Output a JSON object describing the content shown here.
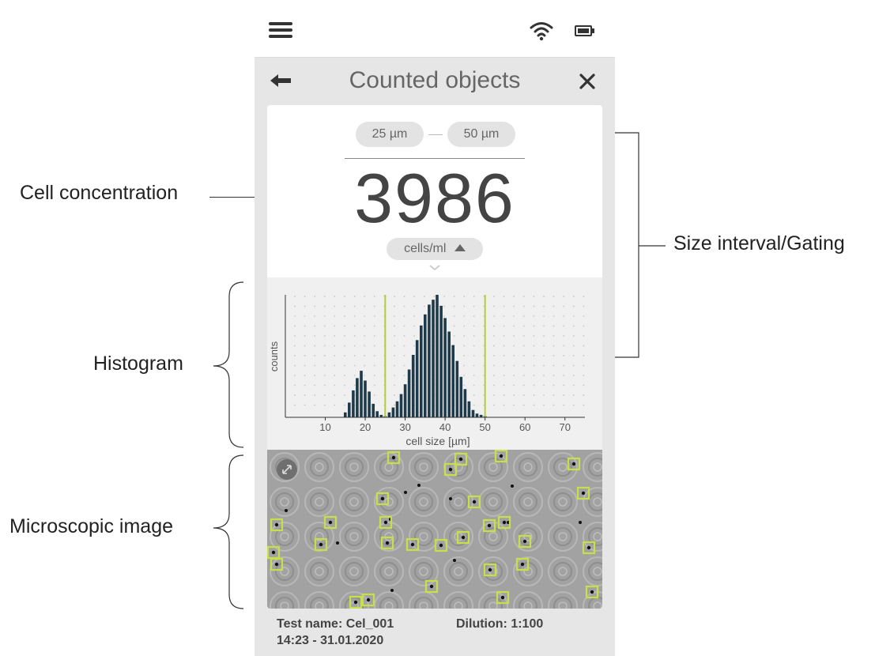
{
  "annotations": {
    "cell_concentration": "Cell concentration",
    "histogram": "Histogram",
    "microscopic_image": "Microscopic image",
    "size_interval": "Size interval/Gating"
  },
  "status_bar": {
    "menu_icon": "hamburger-menu-icon",
    "wifi_icon": "wifi-icon",
    "battery_icon": "battery-icon"
  },
  "title_bar": {
    "title": "Counted objects",
    "back_icon": "arrow-left-icon",
    "close_icon": "close-icon"
  },
  "gating": {
    "lower": "25 µm",
    "upper": "50 µm"
  },
  "concentration": {
    "value": "3986",
    "unit": "cells/ml"
  },
  "chart_data": {
    "type": "bar",
    "xlabel": "cell size [µm]",
    "ylabel": "counts",
    "xlim": [
      0,
      75
    ],
    "ylim": [
      0,
      100
    ],
    "xticks": [
      10,
      20,
      30,
      40,
      50,
      60,
      70
    ],
    "gates": [
      25,
      50
    ],
    "grid": true,
    "bin_width": 1,
    "x": [
      15,
      16,
      17,
      18,
      19,
      20,
      21,
      22,
      23,
      24,
      25,
      26,
      27,
      28,
      29,
      30,
      31,
      32,
      33,
      34,
      35,
      36,
      37,
      38,
      39,
      40,
      41,
      42,
      43,
      44,
      45,
      46,
      47,
      48,
      49,
      50
    ],
    "values": [
      4,
      12,
      22,
      32,
      38,
      30,
      21,
      11,
      5,
      2,
      1,
      4,
      8,
      13,
      19,
      27,
      39,
      51,
      63,
      75,
      84,
      92,
      96,
      100,
      91,
      81,
      70,
      59,
      46,
      33,
      23,
      13,
      6,
      3,
      2,
      1
    ]
  },
  "micro": {
    "expand_icon": "expand-arrows-icon"
  },
  "footer": {
    "test_name": "Test name: Cel_001",
    "dilution": "Dilution: 1:100",
    "datetime": "14:23 - 31.01.2020"
  }
}
